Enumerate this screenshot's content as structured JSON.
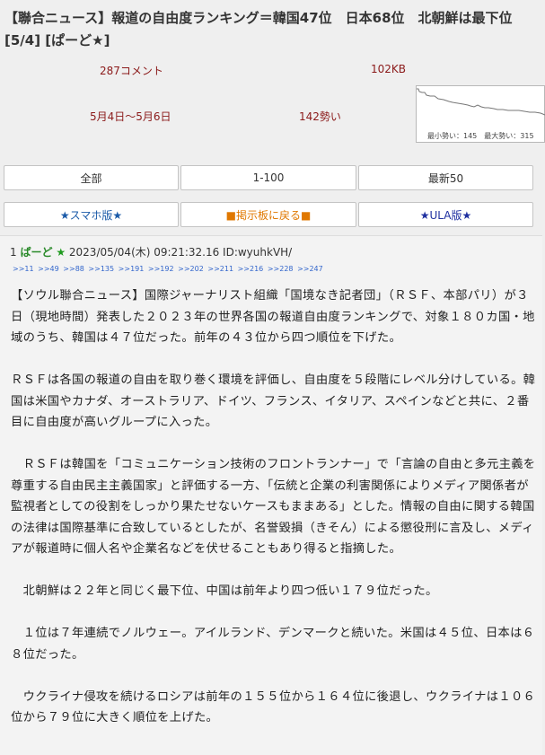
{
  "thread": {
    "title_line1": "【聯合ニュース】報道の自由度ランキング＝韓国47位　日本68位　北朝鮮は最下位",
    "title_line2": "[5/4] [ぱーど★]",
    "comments": "287コメント",
    "size": "102KB",
    "date_range": "5月4日〜5月6日",
    "momentum": "142勢い",
    "graph_caption": "最小勢い：145　最大勢い：315"
  },
  "nav": {
    "all": "全部",
    "range": "1-100",
    "latest": "最新50",
    "smartphone": "★スマホ版★",
    "back_to_board": "■掲示板に戻る■",
    "ula": "★ULA版★"
  },
  "colors": {
    "meta": "#8b1a1a",
    "anchor": "#3366cc",
    "poster": "#2a8a2a"
  },
  "post": {
    "number": "1",
    "name": "ぱーど",
    "star": "★",
    "datetime": "2023/05/04(木) 09:21:32.16 ID:wyuhkVH/",
    "anchors": [
      ">>11",
      ">>49",
      ">>88",
      ">>135",
      ">>191",
      ">>192",
      ">>202",
      ">>211",
      ">>216",
      ">>228",
      ">>247"
    ],
    "paragraphs": [
      "【ソウル聯合ニュース】国際ジャーナリスト組織「国境なき記者団」（ＲＳＦ、本部パリ）が３日（現地時間）発表した２０２３年の世界各国の報道自由度ランキングで、対象１８０カ国・地域のうち、韓国は４７位だった。前年の４３位から四つ順位を下げた。",
      "ＲＳＦは各国の報道の自由を取り巻く環境を評価し、自由度を５段階にレベル分けしている。韓国は米国やカナダ、オーストラリア、ドイツ、フランス、イタリア、スペインなどと共に、２番目に自由度が高いグループに入った。",
      "　ＲＳＦは韓国を「コミュニケーション技術のフロントランナー」で「言論の自由と多元主義を尊重する自由民主主義国家」と評価する一方、「伝統と企業の利害関係によりメディア関係者が監視者としての役割をしっかり果たせないケースもままある」とした。情報の自由に関する韓国の法律は国際基準に合致しているとしたが、名誉毀損（きそん）による懲役刑に言及し、メディアが報道時に個人名や企業名などを伏せることもあり得ると指摘した。",
      "　北朝鮮は２２年と同じく最下位、中国は前年より四つ低い１７９位だった。",
      "　１位は７年連続でノルウェー。アイルランド、デンマークと続いた。米国は４５位、日本は６８位だった。",
      "　ウクライナ侵攻を続けるロシアは前年の１５５位から１６４位に後退し、ウクライナは１０６位から７９位に大きく順位を上げた。"
    ]
  }
}
